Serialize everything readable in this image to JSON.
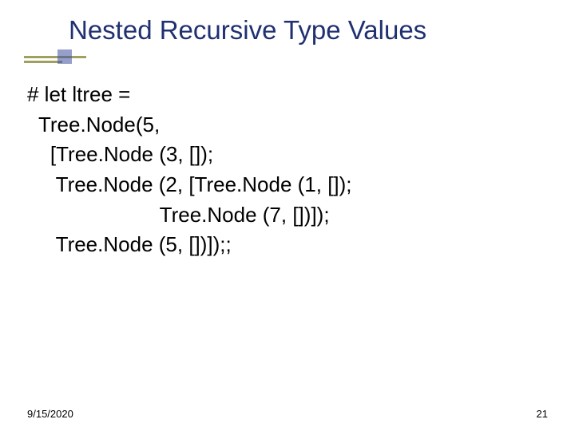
{
  "title": "Nested Recursive Type Values",
  "code": {
    "l1": "# let ltree =",
    "l2": "  Tree.Node(5,",
    "l3": "    [Tree.Node (3, []);",
    "l4": "     Tree.Node (2, [Tree.Node (1, []);",
    "l5": "                       Tree.Node (7, [])]);",
    "l6": "     Tree.Node (5, [])]);;"
  },
  "footer": {
    "date": "9/15/2020",
    "page": "21"
  }
}
